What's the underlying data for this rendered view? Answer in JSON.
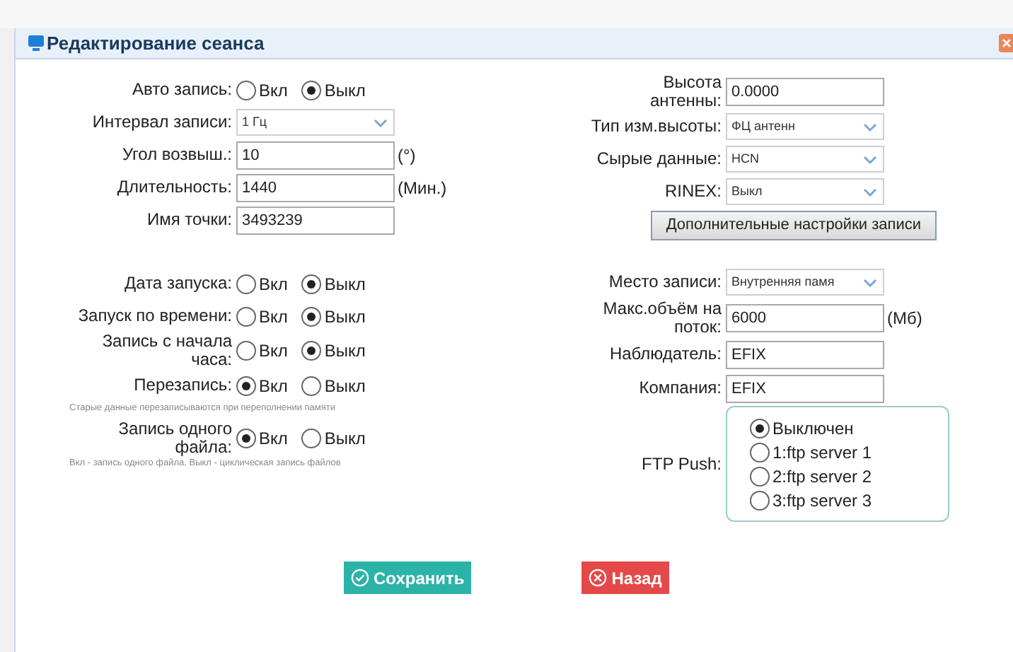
{
  "dialog": {
    "title": "Редактирование сеанса"
  },
  "left_sections": [
    {
      "fields": [
        {
          "kind": "radio",
          "label": "Авто запись:",
          "options": [
            {
              "label": "Вкл",
              "selected": false
            },
            {
              "label": "Выкл",
              "selected": true
            }
          ]
        },
        {
          "kind": "select",
          "label": "Интервал записи:",
          "value": "1 Гц"
        },
        {
          "kind": "text",
          "label": "Угол возвыш.:",
          "value": "10",
          "unit": "(°)"
        },
        {
          "kind": "text",
          "label": "Длительность:",
          "value": "1440",
          "unit": "(Мин.)"
        },
        {
          "kind": "text",
          "label": "Имя точки:",
          "value": "3493239"
        }
      ]
    },
    {
      "fields": [
        {
          "kind": "radio",
          "label": "Дата запуска:",
          "options": [
            {
              "label": "Вкл",
              "selected": false
            },
            {
              "label": "Выкл",
              "selected": true
            }
          ]
        },
        {
          "kind": "radio",
          "label": "Запуск по времени:",
          "options": [
            {
              "label": "Вкл",
              "selected": false
            },
            {
              "label": "Выкл",
              "selected": true
            }
          ]
        },
        {
          "kind": "radio",
          "label": "Запись с начала часа:",
          "options": [
            {
              "label": "Вкл",
              "selected": false
            },
            {
              "label": "Выкл",
              "selected": true
            }
          ]
        },
        {
          "kind": "radio",
          "label": "Перезапись:",
          "options": [
            {
              "label": "Вкл",
              "selected": true
            },
            {
              "label": "Выкл",
              "selected": false
            }
          ],
          "hint": "Старые данные перезаписываются при переполнении памяти"
        },
        {
          "kind": "radio",
          "label": "Запись одного файла:",
          "options": [
            {
              "label": "Вкл",
              "selected": true
            },
            {
              "label": "Выкл",
              "selected": false
            }
          ],
          "hint": "Вкл - запись одного файла. Выкл - циклическая запись файлов"
        }
      ]
    }
  ],
  "right_sections": [
    {
      "fields": [
        {
          "kind": "text",
          "label": "Высота антенны:",
          "value": "0.0000"
        },
        {
          "kind": "select",
          "label": "Тип изм.высоты:",
          "value": "ФЦ антенн"
        },
        {
          "kind": "select",
          "label": "Сырые данные:",
          "value": "HCN"
        },
        {
          "kind": "select",
          "label": "RINEX:",
          "value": "Выкл"
        },
        {
          "kind": "button",
          "label": "Дополнительные настройки записи"
        }
      ]
    },
    {
      "fields": [
        {
          "kind": "select",
          "label": "Место записи:",
          "value": "Внутренняя памя"
        },
        {
          "kind": "text",
          "label": "Макс.объём на поток:",
          "value": "6000",
          "unit": "(Мб)"
        },
        {
          "kind": "text",
          "label": "Наблюдатель:",
          "value": "EFIX"
        },
        {
          "kind": "text",
          "label": "Компания:",
          "value": "EFIX"
        },
        {
          "kind": "radiolist",
          "label": "FTP Push:",
          "options": [
            {
              "label": "Выключен",
              "selected": true
            },
            {
              "label": "1:ftp server 1",
              "selected": false
            },
            {
              "label": "2:ftp server 2",
              "selected": false
            },
            {
              "label": "3:ftp server 3",
              "selected": false
            }
          ]
        }
      ]
    }
  ],
  "buttons": [
    {
      "kind": "save",
      "label": "Сохранить"
    },
    {
      "kind": "back",
      "label": "Назад"
    }
  ]
}
